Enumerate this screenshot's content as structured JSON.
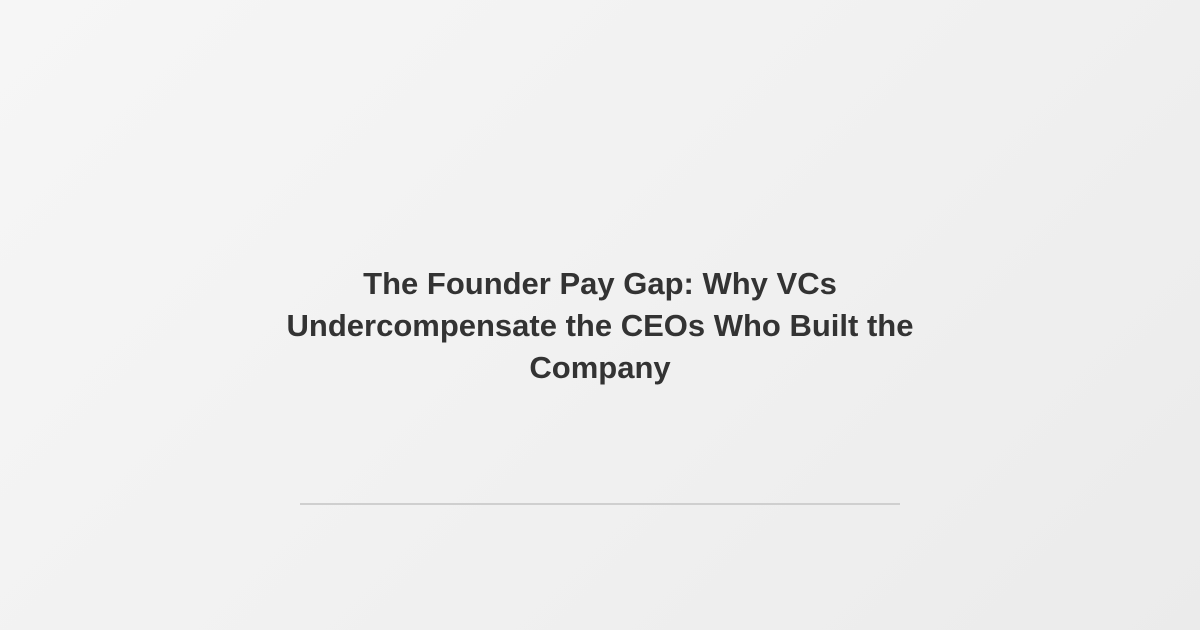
{
  "card": {
    "title": "The Founder Pay Gap: Why VCs Undercompensate the CEOs Who Built the Company"
  },
  "colors": {
    "background": "#f1f1f1",
    "title_text": "#333333",
    "divider": "#cfcfcf"
  }
}
